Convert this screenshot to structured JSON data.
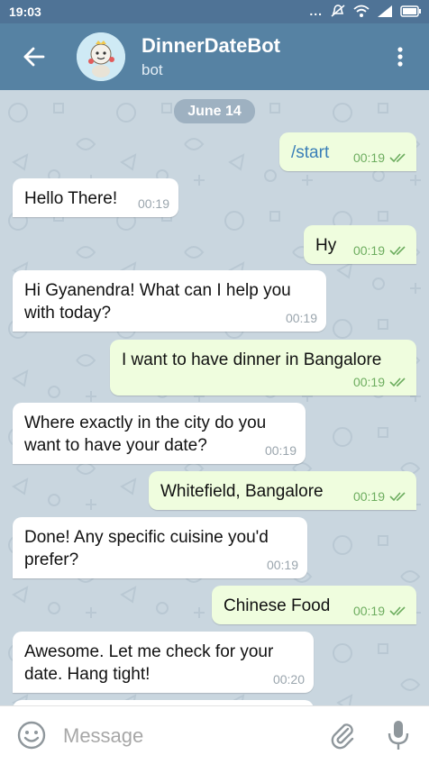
{
  "status_bar": {
    "time": "19:03",
    "dots": "..."
  },
  "header": {
    "title": "DinnerDateBot",
    "subtitle": "bot"
  },
  "date_chip": "June 14",
  "messages": [
    {
      "dir": "out",
      "text": "/start",
      "time": "00:19",
      "is_command": true
    },
    {
      "dir": "in",
      "text": "Hello There!",
      "time": "00:19"
    },
    {
      "dir": "out",
      "text": "Hy",
      "time": "00:19"
    },
    {
      "dir": "in",
      "text": "Hi Gyanendra! What can I help you with today?",
      "time": "00:19"
    },
    {
      "dir": "out",
      "text": "I want to have dinner in Bangalore",
      "time": "00:19"
    },
    {
      "dir": "in",
      "text": "Where exactly in the city do you want to have your date?",
      "time": "00:19"
    },
    {
      "dir": "out",
      "text": "Whitefield, Bangalore",
      "time": "00:19"
    },
    {
      "dir": "in",
      "text": "Done! Any specific cuisine you'd prefer?",
      "time": "00:19"
    },
    {
      "dir": "out",
      "text": "Chinese Food",
      "time": "00:19"
    },
    {
      "dir": "in",
      "text": "Awesome. Let me check for your date. Hang tight!",
      "time": "00:20"
    }
  ],
  "composer": {
    "placeholder": "Message"
  },
  "colors": {
    "header": "#5682a3",
    "status_bar": "#4f7396",
    "outgoing_bubble": "#effdde",
    "incoming_bubble": "#ffffff",
    "read_check": "#6dad5f"
  },
  "icons": [
    "back-arrow-icon",
    "more-vert-icon",
    "emoji-icon",
    "attach-icon",
    "mic-icon",
    "double-check-icon",
    "wifi-icon",
    "signal-icon",
    "battery-icon",
    "mute-icon"
  ]
}
